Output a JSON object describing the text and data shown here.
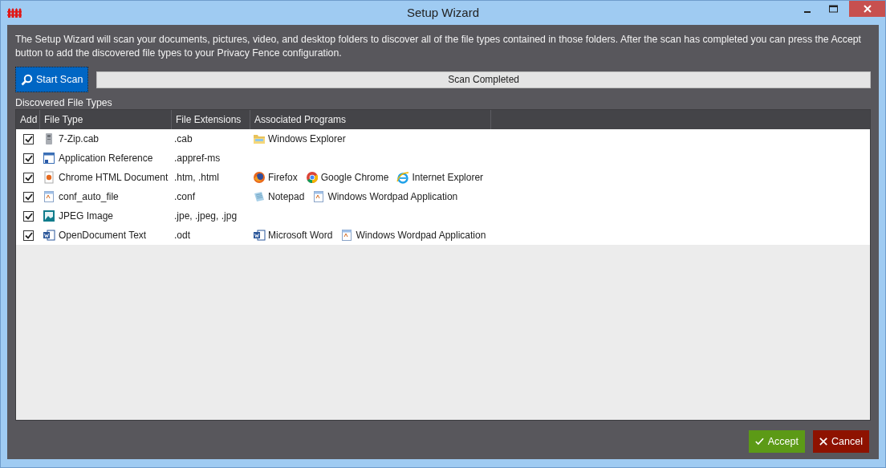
{
  "window": {
    "title": "Setup Wizard"
  },
  "description": "The Setup Wizard will scan your documents, pictures, video, and desktop folders to discover all of the file types contained in those folders. After the scan has completed you can press the Accept button to add the discovered file types to your Privacy Fence configuration.",
  "scan_button": "Start Scan",
  "progress": {
    "level": 1,
    "label": "Scan Completed"
  },
  "table": {
    "title": "Discovered File Types",
    "columns": [
      "Add",
      "File Type",
      "File Extensions",
      "Associated Programs"
    ],
    "rows": [
      {
        "checked": true,
        "kind": "archive",
        "file_type": "7-Zip.cab",
        "extensions": ".cab",
        "programs": [
          {
            "kind": "folder",
            "name": "Windows Explorer"
          }
        ]
      },
      {
        "checked": true,
        "kind": "shortcut",
        "file_type": "Application Reference",
        "extensions": ".appref-ms",
        "programs": []
      },
      {
        "checked": true,
        "kind": "web",
        "file_type": "Chrome HTML Document",
        "extensions": ".htm, .html",
        "programs": [
          {
            "kind": "firefox",
            "name": "Firefox"
          },
          {
            "kind": "chrome",
            "name": "Google Chrome"
          },
          {
            "kind": "ie",
            "name": "Internet Explorer"
          }
        ]
      },
      {
        "checked": true,
        "kind": "document",
        "file_type": "conf_auto_file",
        "extensions": ".conf",
        "programs": [
          {
            "kind": "notepad",
            "name": "Notepad"
          },
          {
            "kind": "document",
            "name": "Windows Wordpad Application"
          }
        ]
      },
      {
        "checked": true,
        "kind": "image",
        "file_type": "JPEG Image",
        "extensions": ".jpe, .jpeg, .jpg",
        "programs": []
      },
      {
        "checked": true,
        "kind": "word",
        "file_type": "OpenDocument Text",
        "extensions": ".odt",
        "programs": [
          {
            "kind": "word",
            "name": "Microsoft Word"
          },
          {
            "kind": "document",
            "name": "Windows Wordpad Application"
          }
        ]
      }
    ]
  },
  "buttons": [
    {
      "kind": "accept",
      "label": "Accept"
    },
    {
      "kind": "cancel",
      "label": "Cancel"
    }
  ]
}
